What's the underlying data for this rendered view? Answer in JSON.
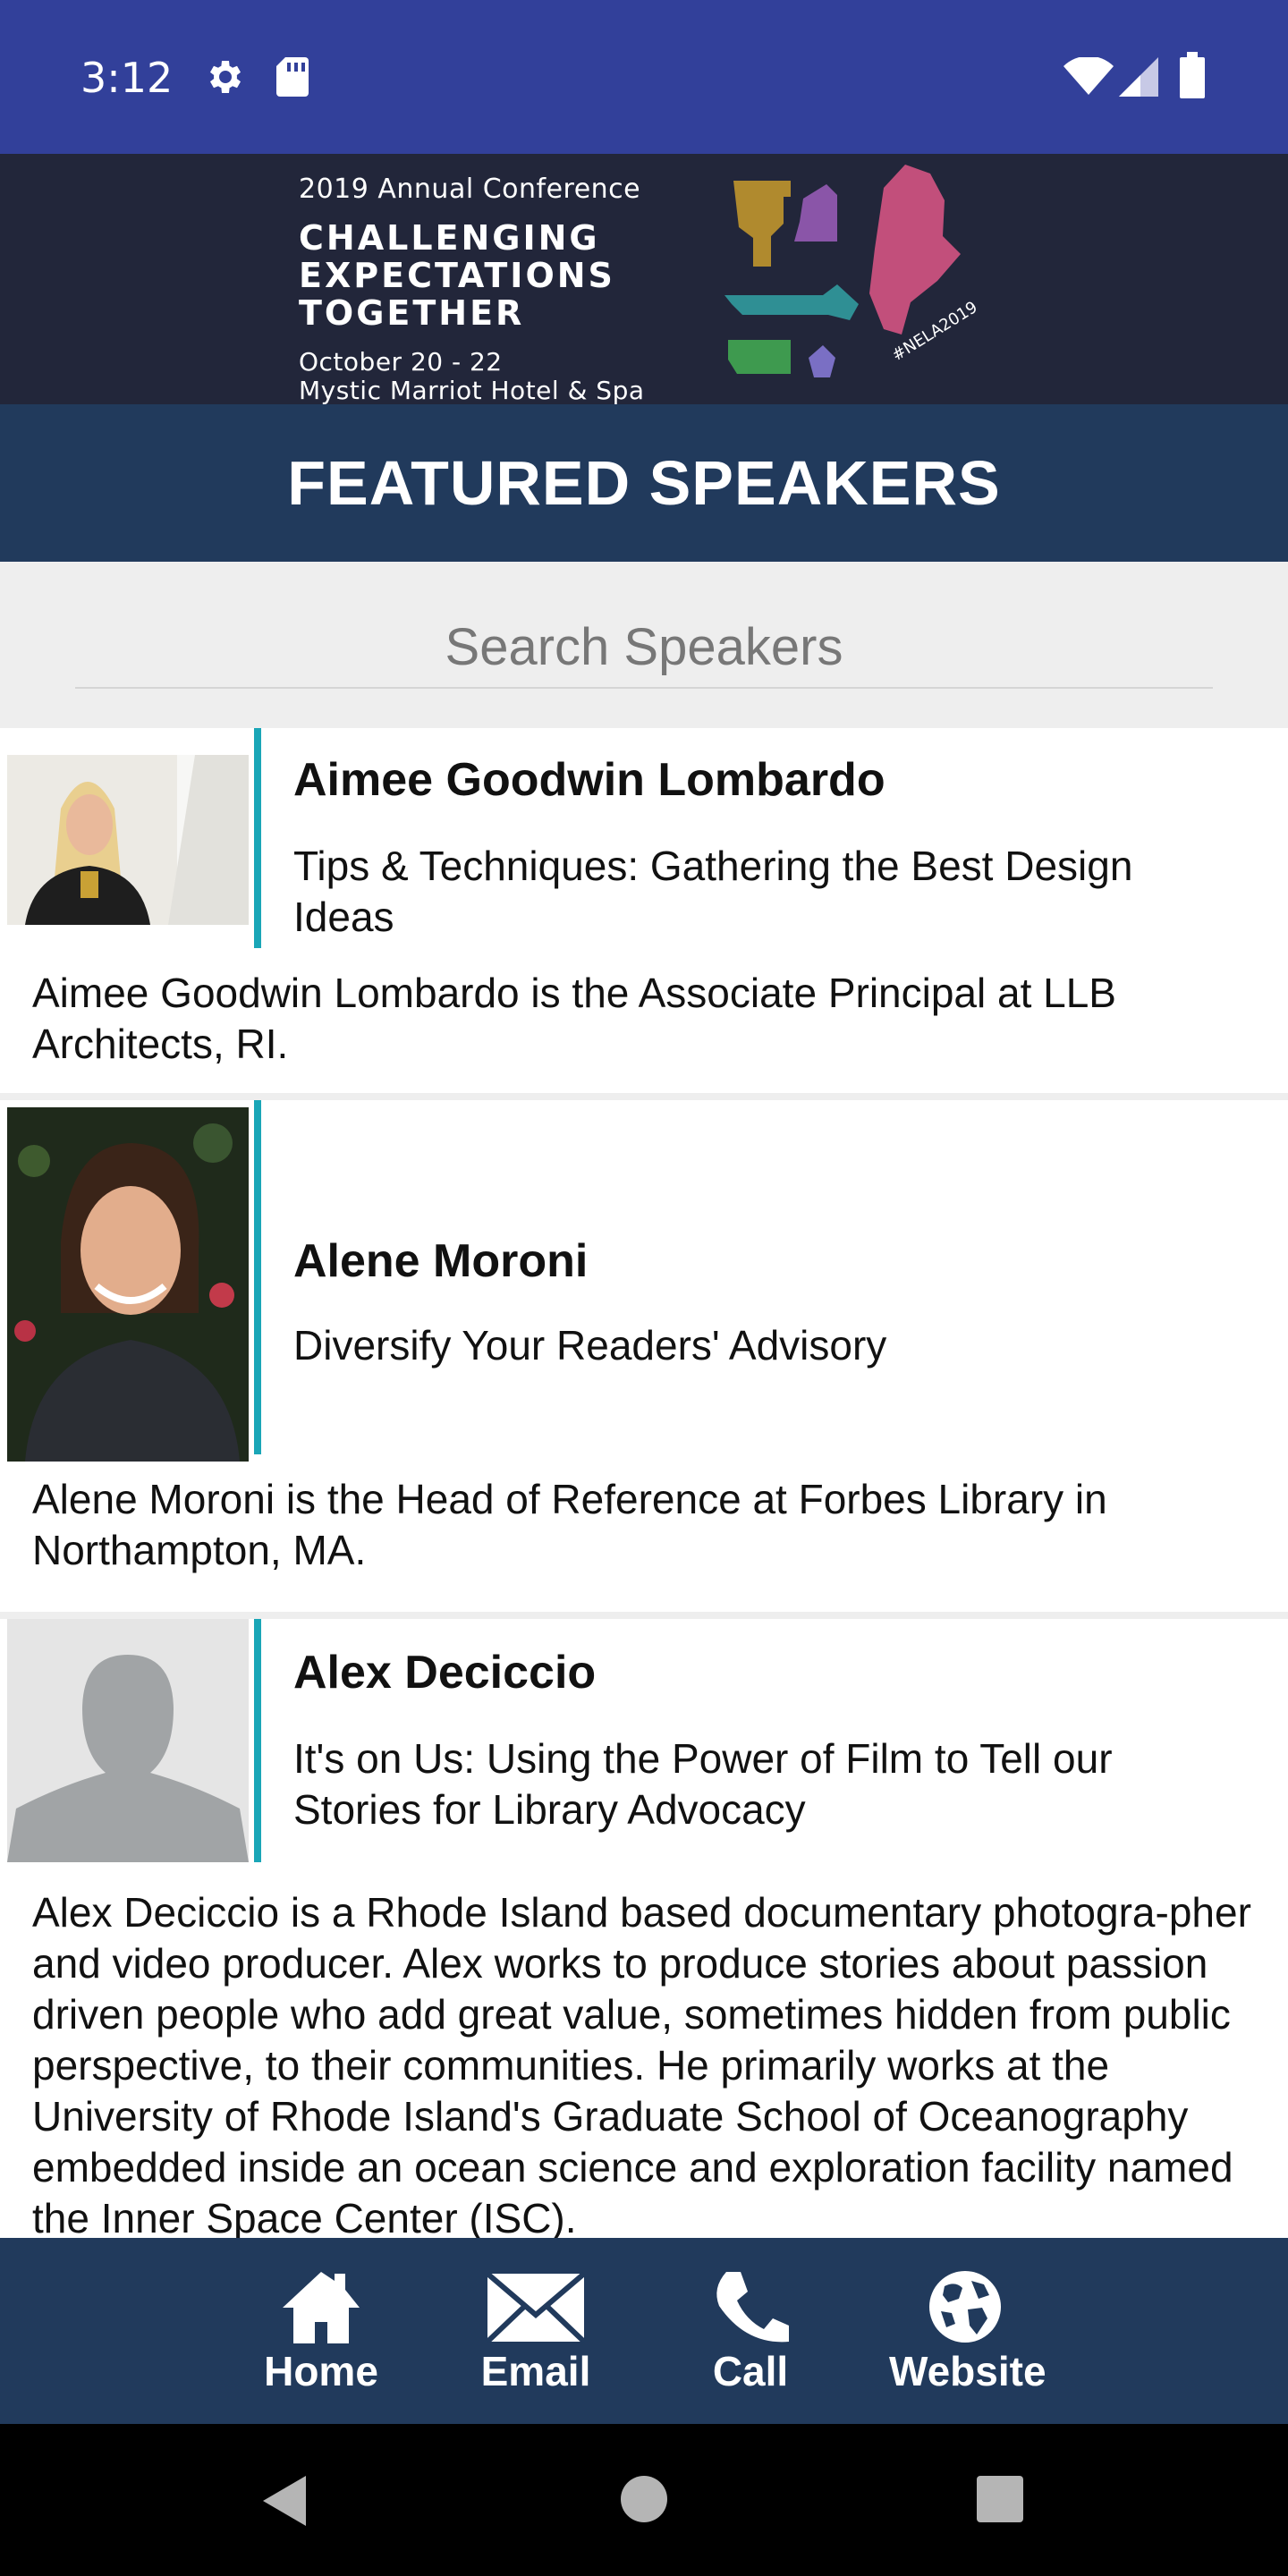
{
  "status_bar": {
    "time": "3:12",
    "icons": [
      "gear-icon",
      "sd-card-icon",
      "wifi-icon",
      "signal-icon",
      "battery-icon"
    ],
    "color": "#32409a"
  },
  "banner": {
    "line1": "2019 Annual Conference",
    "headline_1": "CHALLENGING",
    "headline_2": "EXPECTATIONS",
    "headline_3": "TOGETHER",
    "date": "October 20 - 22",
    "venue": "Mystic Marriot Hotel & Spa",
    "hashtag": "#NELA2019",
    "map_colors": [
      "#b08a2e",
      "#8a55a8",
      "#c24f7b",
      "#2f8f94",
      "#3e9a4f",
      "#7a6fc4"
    ]
  },
  "header": {
    "title": "FEATURED SPEAKERS",
    "color": "#213a5c"
  },
  "search": {
    "placeholder": "Search Speakers"
  },
  "speakers": [
    {
      "name": "Aimee Goodwin Lombardo",
      "session": "Tips & Techniques: Gathering the Best Design Ideas",
      "bio": "Aimee Goodwin Lombardo is the Associate Principal at LLB Architects, RI."
    },
    {
      "name": "Alene Moroni",
      "session": "Diversify Your Readers' Advisory",
      "bio": "Alene Moroni is the Head of Reference at Forbes Library in Northampton, MA."
    },
    {
      "name": "Alex Deciccio",
      "session": "It's on Us: Using the Power of Film to Tell our Stories for Library Advocacy",
      "bio": "Alex Deciccio is a Rhode Island based documentary photogra-pher and video producer.  Alex works to produce stories about passion driven people who add great value, sometimes hidden from public perspective, to their communities.  He primarily works at the University of Rhode Island's Graduate School of Oceanography embedded inside an ocean science and exploration facility named the Inner Space Center (ISC)."
    }
  ],
  "bottom_nav": [
    {
      "label": "Home",
      "icon": "home-icon"
    },
    {
      "label": "Email",
      "icon": "envelope-icon"
    },
    {
      "label": "Call",
      "icon": "phone-icon"
    },
    {
      "label": "Website",
      "icon": "globe-icon"
    }
  ],
  "accent_color": "#1aa6b7"
}
